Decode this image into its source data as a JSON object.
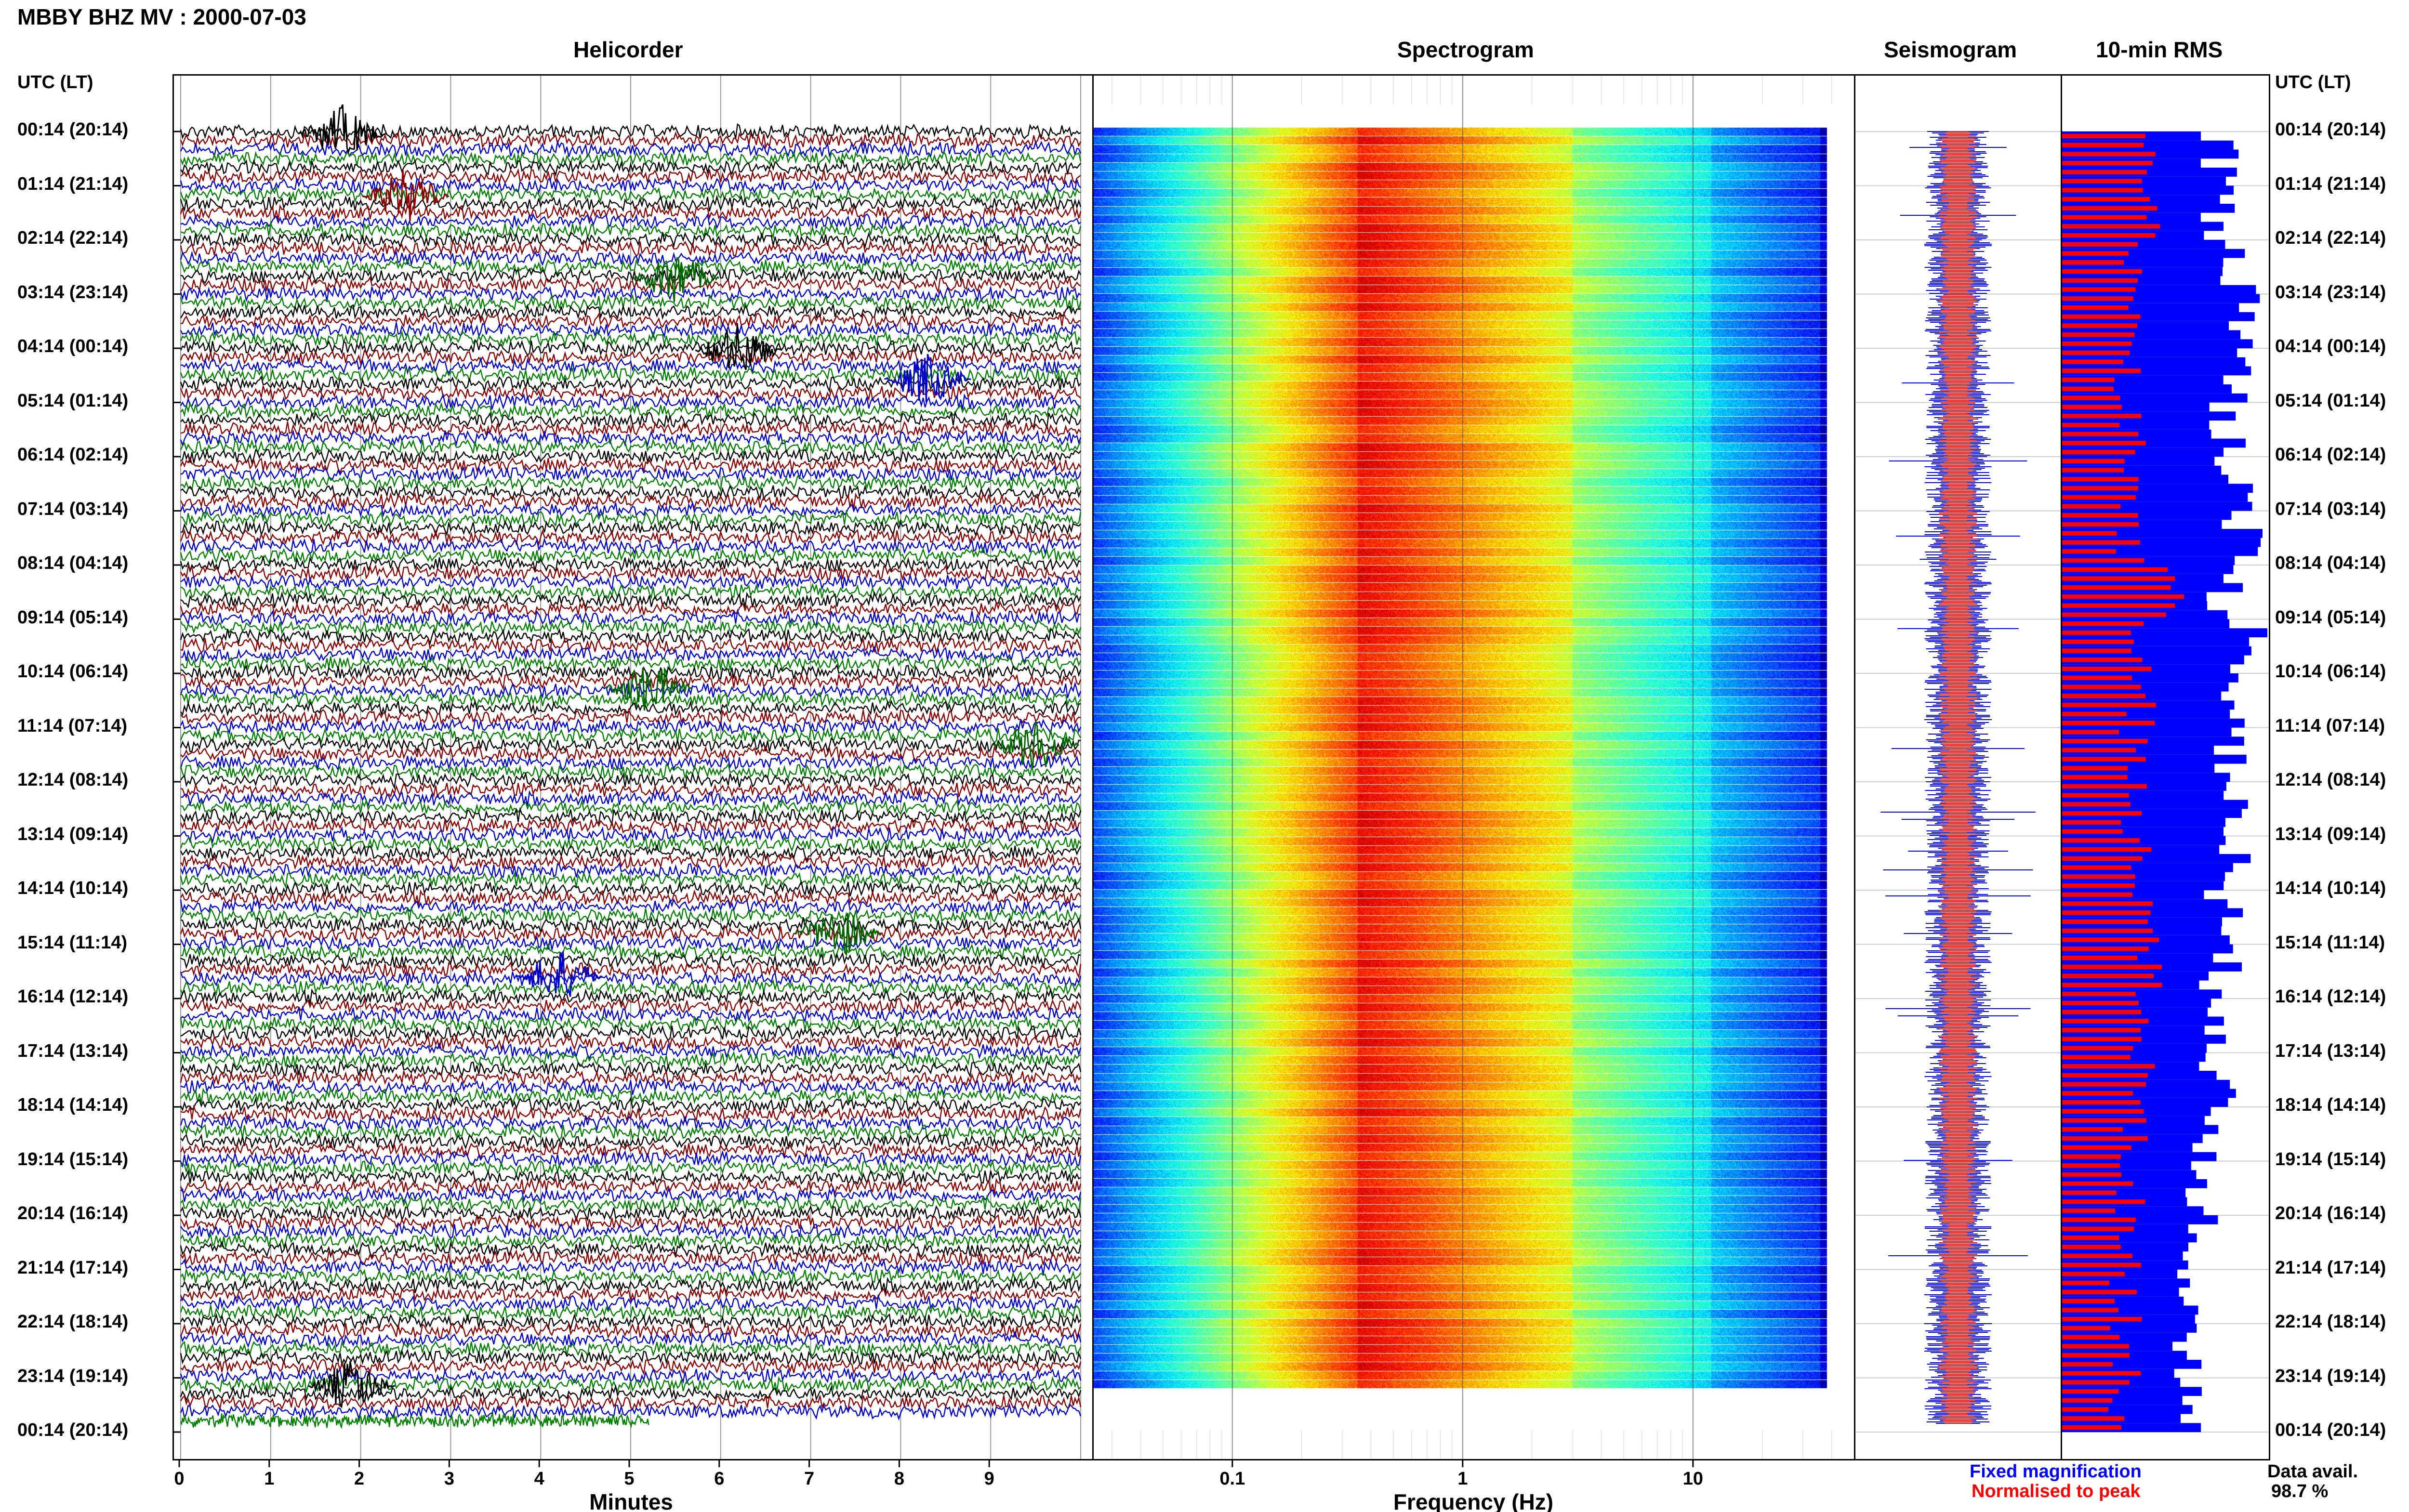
{
  "header": {
    "title": "MBBY BHZ MV : 2000-07-03"
  },
  "panels": {
    "helicorder": "Helicorder",
    "spectrogram": "Spectrogram",
    "seismogram": "Seismogram",
    "rms": "10-min RMS"
  },
  "axes": {
    "left_label": "UTC (LT)",
    "right_label": "UTC (LT)",
    "minutes_title": "Minutes",
    "frequency_title": "Frequency (Hz)"
  },
  "legend": {
    "fixed": "Fixed magnification",
    "normalised": "Normalised to peak",
    "fixed_color": "#0000ff",
    "normalised_color": "#ff0000",
    "avail_label": "Data avail.",
    "avail_value": "98.7 %"
  },
  "chart_data": {
    "type": "heatmap",
    "time_labels": [
      "00:14 (20:14)",
      "01:14 (21:14)",
      "02:14 (22:14)",
      "03:14 (23:14)",
      "04:14 (00:14)",
      "05:14 (01:14)",
      "06:14 (02:14)",
      "07:14 (03:14)",
      "08:14 (04:14)",
      "09:14 (05:14)",
      "10:14 (06:14)",
      "11:14 (07:14)",
      "12:14 (08:14)",
      "13:14 (09:14)",
      "14:14 (10:14)",
      "15:14 (11:14)",
      "16:14 (12:14)",
      "17:14 (13:14)",
      "18:14 (14:14)",
      "19:14 (15:14)",
      "20:14 (16:14)",
      "21:14 (17:14)",
      "22:14 (18:14)",
      "23:14 (19:14)",
      "00:14 (20:14)"
    ],
    "minutes_ticks": [
      "0",
      "1",
      "2",
      "3",
      "4",
      "5",
      "6",
      "7",
      "8",
      "9"
    ],
    "minutes_range": [
      0,
      10
    ],
    "frequency_ticks": [
      "0.1",
      "1",
      "10"
    ],
    "frequency_range": [
      0.025,
      50
    ],
    "frequency_scale": "log",
    "trace_colors": [
      "#000000",
      "#8b0000",
      "#0000cd",
      "#008000"
    ],
    "spectral_peak_hz": 0.35,
    "rms_fixed": [
      0.75,
      0.78,
      0.86,
      0.9,
      0.84,
      0.82,
      0.85,
      0.88,
      0.8,
      0.92,
      0.86,
      0.83,
      0.81,
      0.84,
      0.79,
      0.77,
      0.8,
      0.74,
      0.72,
      0.7,
      0.68,
      0.65,
      0.64,
      0.6
    ],
    "rms_normalised": [
      0.45,
      0.4,
      0.35,
      0.38,
      0.33,
      0.34,
      0.36,
      0.32,
      0.55,
      0.36,
      0.38,
      0.35,
      0.34,
      0.4,
      0.42,
      0.41,
      0.4,
      0.38,
      0.35,
      0.33,
      0.33,
      0.31,
      0.31,
      0.3
    ],
    "data_availability_percent": 98.7
  }
}
